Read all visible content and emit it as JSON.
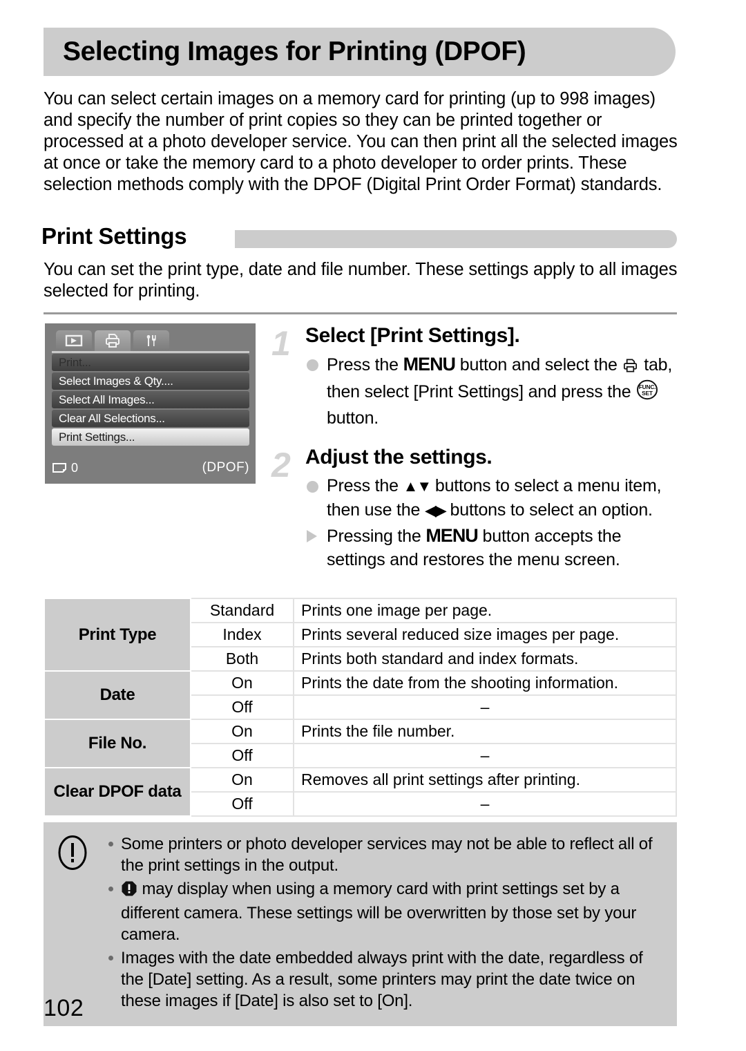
{
  "page": {
    "title": "Selecting Images for Printing (DPOF)",
    "number": "102",
    "intro": "You can select certain images on a memory card for printing (up to 998 images) and specify the number of print copies so they can be printed together or processed at a photo developer service. You can then print all the selected images at once or take the memory card to a photo developer to order prints. These selection methods comply with the DPOF (Digital Print Order Format) standards."
  },
  "section": {
    "heading": "Print Settings",
    "intro": "You can set the print type, date and file number. These settings apply to all images selected for printing."
  },
  "lcd": {
    "tabs": [
      {
        "name": "playback-tab",
        "icon": "playback-icon"
      },
      {
        "name": "print-tab",
        "icon": "printer-icon"
      },
      {
        "name": "settings-tab",
        "icon": "wrench-icon"
      }
    ],
    "items": [
      {
        "label": "Print...",
        "state": "dim"
      },
      {
        "label": "Select Images & Qty....",
        "state": "normal"
      },
      {
        "label": "Select All Images...",
        "state": "normal"
      },
      {
        "label": "Clear All Selections...",
        "state": "normal"
      },
      {
        "label": "Print Settings...",
        "state": "selected"
      }
    ],
    "footer": {
      "count": "0",
      "count_icon": "print-count-icon",
      "mode": "(DPOF)"
    }
  },
  "steps": [
    {
      "number": "1",
      "title": "Select [Print Settings].",
      "lines": [
        {
          "marker": "dot",
          "parts": [
            {
              "t": "text",
              "v": "Press the "
            },
            {
              "t": "menu",
              "v": "MENU"
            },
            {
              "t": "text",
              "v": " button and select the "
            },
            {
              "t": "icon",
              "v": "printer-icon"
            },
            {
              "t": "text",
              "v": " tab, then select [Print Settings] and press the "
            },
            {
              "t": "icon",
              "v": "func-set-icon"
            },
            {
              "t": "text",
              "v": " button."
            }
          ]
        }
      ]
    },
    {
      "number": "2",
      "title": "Adjust the settings.",
      "lines": [
        {
          "marker": "dot",
          "parts": [
            {
              "t": "text",
              "v": "Press the "
            },
            {
              "t": "icon",
              "v": "up-down-arrows-icon"
            },
            {
              "t": "text",
              "v": " buttons to select a menu item, then use the "
            },
            {
              "t": "icon",
              "v": "left-right-arrows-icon"
            },
            {
              "t": "text",
              "v": " buttons to select an option."
            }
          ]
        },
        {
          "marker": "triangle",
          "parts": [
            {
              "t": "text",
              "v": "Pressing the "
            },
            {
              "t": "menu",
              "v": "MENU"
            },
            {
              "t": "text",
              "v": " button accepts the settings and restores the menu screen."
            }
          ]
        }
      ]
    }
  ],
  "table": {
    "rows": [
      {
        "label": "Print Type",
        "span": 3,
        "option": "Standard",
        "desc": "Prints one image per page."
      },
      {
        "label": "",
        "span": 0,
        "option": "Index",
        "desc": "Prints several reduced size images per page."
      },
      {
        "label": "",
        "span": 0,
        "option": "Both",
        "desc": "Prints both standard and index formats."
      },
      {
        "label": "Date",
        "span": 2,
        "option": "On",
        "desc": "Prints the date from the shooting information."
      },
      {
        "label": "",
        "span": 0,
        "option": "Off",
        "desc": "–"
      },
      {
        "label": "File No.",
        "span": 2,
        "option": "On",
        "desc": "Prints the file number."
      },
      {
        "label": "",
        "span": 0,
        "option": "Off",
        "desc": "–"
      },
      {
        "label": "Clear DPOF data",
        "span": 2,
        "option": "On",
        "desc": "Removes all print settings after printing."
      },
      {
        "label": "",
        "span": 0,
        "option": "Off",
        "desc": "–"
      }
    ]
  },
  "notes": {
    "icon": "caution-icon",
    "items": [
      {
        "parts": [
          {
            "t": "text",
            "v": "Some printers or photo developer services may not be able to reflect all of the print settings in the output."
          }
        ]
      },
      {
        "parts": [
          {
            "t": "icon",
            "v": "exclamation-octagon-icon"
          },
          {
            "t": "text",
            "v": " may display when using a memory card with print settings set by a different camera. These settings will be overwritten by those set by your camera."
          }
        ]
      },
      {
        "parts": [
          {
            "t": "text",
            "v": "Images with the date embedded always print with the date, regardless of the [Date] setting. As a result, some printers may print the date twice on these images if [Date] is also set to [On]."
          }
        ]
      }
    ]
  },
  "colors": {
    "accent_gray": "#cccccc",
    "lcd_bg": "#7d7d7d",
    "step_num": "#d3d3d3"
  }
}
